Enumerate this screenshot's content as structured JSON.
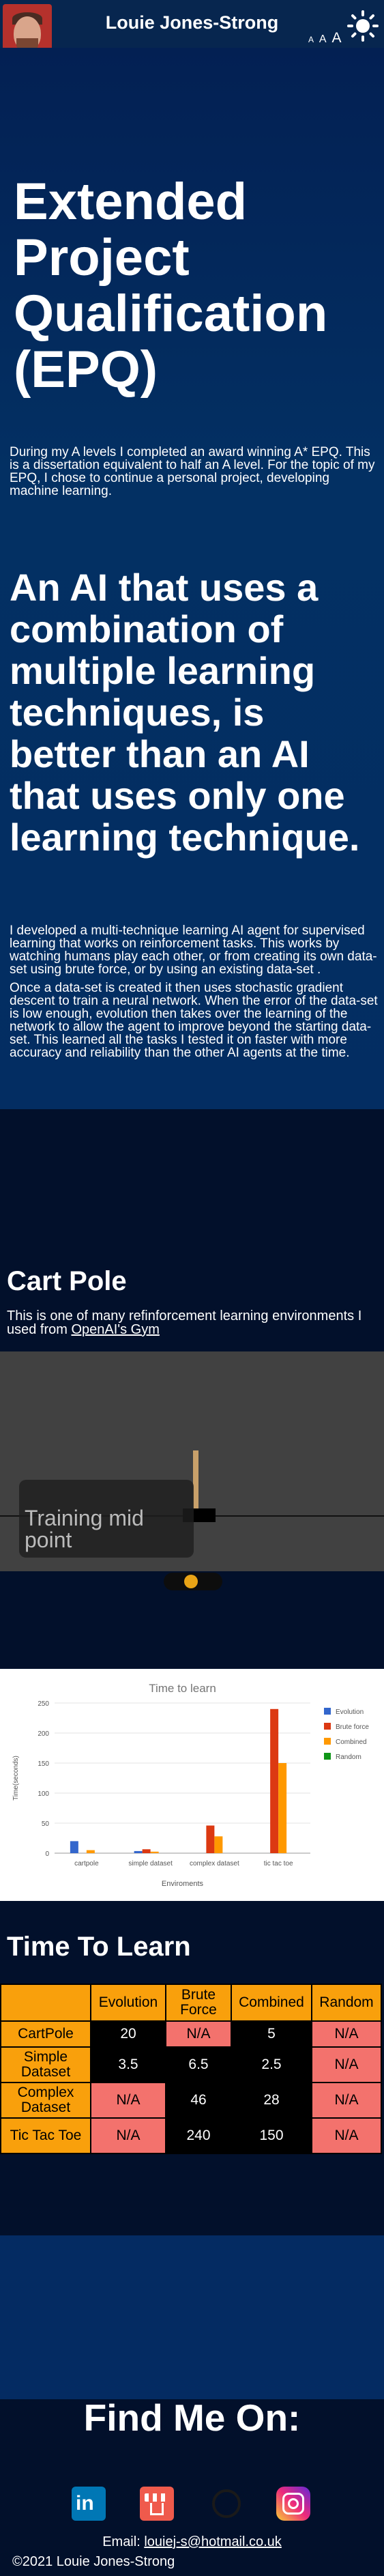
{
  "header": {
    "name": "Louie Jones-Strong",
    "font_small": "A",
    "font_medium": "A",
    "font_large": "A",
    "theme_icon": "sun-icon"
  },
  "hero": {
    "title": "Extended Project Qualification (EPQ)",
    "intro": "During my A levels I completed an award winning A* EPQ. This is a dissertation equivalent to half an A level. For the topic of my EPQ, I chose to continue a personal project, developing machine learning."
  },
  "thesis": {
    "statement": "An AI that uses a combination of multiple learning techniques, is better than an AI that uses only one learning technique.",
    "p1": "I developed a multi-technique learning AI agent for supervised learning that works on reinforcement tasks. This works by watching humans play each other, or from creating its own data-set using brute force, or by using an existing data-set .",
    "p2": "Once a data-set is created it then uses stochastic gradient descent to train a neural network. When the error of the data-set is low enough, evolution then takes over the learning of the network to allow the agent to improve beyond the starting data-set. This learned all the tasks I tested it on faster with more accuracy and reliability than the other AI agents at the time."
  },
  "cartpole": {
    "heading": "Cart Pole",
    "desc_prefix": "This is one of many refinforcement learning environments I used from ",
    "desc_link": "OpenAI's Gym",
    "video_caption": "Training mid point"
  },
  "chart_data": {
    "type": "bar",
    "title": "Time to learn",
    "xlabel": "Enviroments",
    "ylabel": "Time(seconds)",
    "ylim": [
      0,
      250
    ],
    "yticks": [
      0,
      50,
      100,
      150,
      200,
      250
    ],
    "categories": [
      "cartpole",
      "simple dataset",
      "complex dataset",
      "tic tac toe"
    ],
    "series": [
      {
        "name": "Evolution",
        "color": "#3366cc",
        "values": [
          20,
          3.5,
          null,
          null
        ]
      },
      {
        "name": "Brute force",
        "color": "#dc3912",
        "values": [
          null,
          6.5,
          46,
          240
        ]
      },
      {
        "name": "Combined",
        "color": "#ff9900",
        "values": [
          5,
          2.5,
          28,
          150
        ]
      },
      {
        "name": "Random",
        "color": "#109618",
        "values": [
          null,
          null,
          null,
          null
        ]
      }
    ],
    "legend": "right",
    "grid": true
  },
  "table": {
    "heading": "Time To Learn",
    "headers": [
      "",
      "Evolution",
      "Brute Force",
      "Combined",
      "Random"
    ],
    "rows": [
      {
        "label": "CartPole",
        "cells": [
          "20",
          "N/A",
          "5",
          "N/A"
        ]
      },
      {
        "label": "Simple Dataset",
        "cells": [
          "3.5",
          "6.5",
          "2.5",
          "N/A"
        ]
      },
      {
        "label": "Complex Dataset",
        "cells": [
          "N/A",
          "46",
          "28",
          "N/A"
        ]
      },
      {
        "label": "Tic Tac Toe",
        "cells": [
          "N/A",
          "240",
          "150",
          "N/A"
        ]
      }
    ]
  },
  "footer": {
    "find_me": "Find Me On:",
    "email_label": "Email: ",
    "email": "louiej-s@hotmail.co.uk",
    "copyright": "©2021 Louie Jones-Strong",
    "socials": [
      "linkedin-icon",
      "shop-icon",
      "github-icon",
      "instagram-icon"
    ],
    "linkedin_glyph": "in"
  },
  "colors": {
    "navy": "#032053",
    "dark": "#02102b",
    "orange": "#f9a00c",
    "salmon": "#f3726d"
  }
}
